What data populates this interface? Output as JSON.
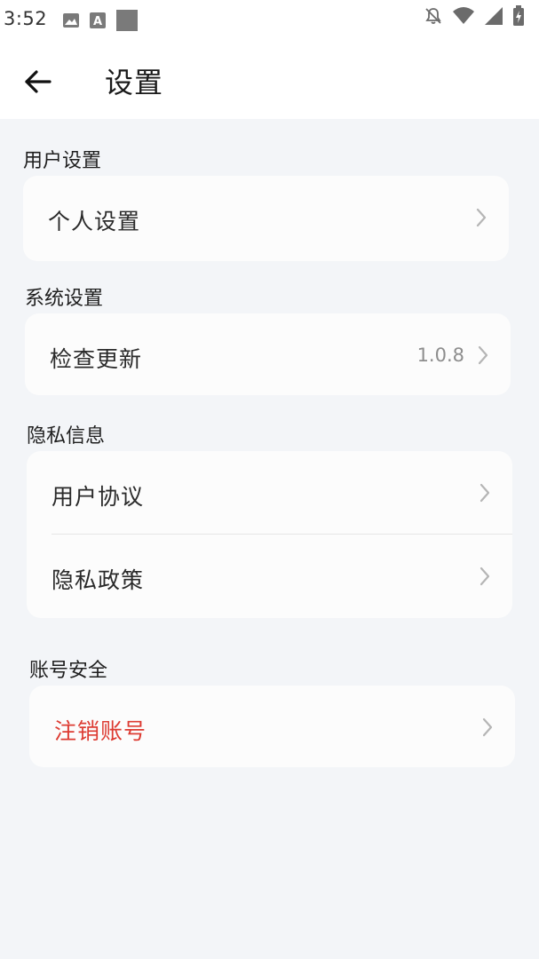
{
  "status_bar": {
    "time": "3:52",
    "left_icons": [
      "image-icon",
      "text-a-icon",
      "square-icon"
    ],
    "right_icons": [
      "bell-off-icon",
      "wifi-icon",
      "signal-icon",
      "battery-charging-icon"
    ]
  },
  "header": {
    "back_icon": "arrow-left-icon",
    "title": "设置"
  },
  "sections": [
    {
      "title": "用户设置",
      "items": [
        {
          "label": "个人设置",
          "value": ""
        }
      ]
    },
    {
      "title": "系统设置",
      "items": [
        {
          "label": "检查更新",
          "value": "1.0.8"
        }
      ]
    },
    {
      "title": "隐私信息",
      "items": [
        {
          "label": "用户协议",
          "value": ""
        },
        {
          "label": "隐私政策",
          "value": ""
        }
      ]
    },
    {
      "title": "账号安全",
      "items": [
        {
          "label": "注销账号",
          "value": ""
        }
      ]
    }
  ],
  "colors": {
    "background": "#f3f5f8",
    "card": "#fcfcfc",
    "danger": "#dd3b32",
    "secondary_text": "#8d8d8d"
  }
}
